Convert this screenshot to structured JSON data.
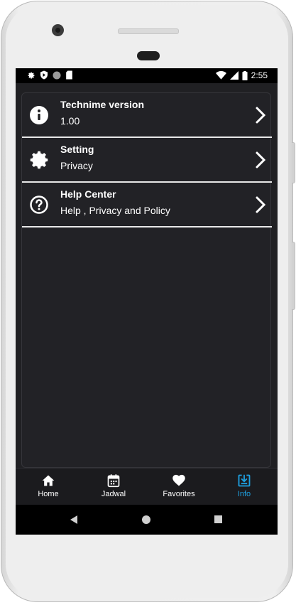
{
  "status_bar": {
    "time": "2:55",
    "left_icons": [
      "settings-icon",
      "shield-icon",
      "circle-icon",
      "sd-card-icon"
    ],
    "right_icons": [
      "wifi-icon",
      "signal-icon",
      "battery-icon"
    ]
  },
  "info_items": [
    {
      "title": "Technime version",
      "subtitle": "1.00",
      "icon": "info-icon"
    },
    {
      "title": "Setting",
      "subtitle": "Privacy",
      "icon": "gear-icon"
    },
    {
      "title": "Help Center",
      "subtitle": "Help , Privacy and Policy",
      "icon": "help-icon"
    }
  ],
  "bottom_nav": [
    {
      "label": "Home",
      "icon": "home-icon",
      "active": false
    },
    {
      "label": "Jadwal",
      "icon": "calendar-icon",
      "active": false
    },
    {
      "label": "Favorites",
      "icon": "heart-icon",
      "active": false
    },
    {
      "label": "Info",
      "icon": "info-download-icon",
      "active": true
    }
  ],
  "colors": {
    "background": "#202023",
    "accent": "#1ea0e0",
    "text": "#ffffff",
    "divider": "#e8e8e8"
  },
  "system_nav": [
    "back-icon",
    "home-circle-icon",
    "recents-icon"
  ]
}
